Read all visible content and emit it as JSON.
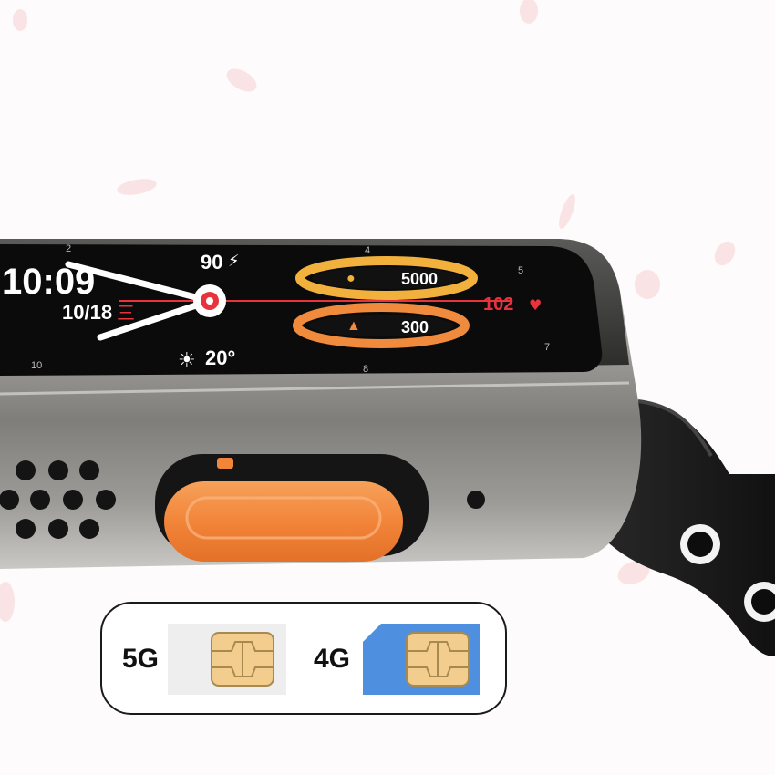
{
  "watch_face": {
    "time": "10:09",
    "date": "10/18",
    "weekday": "三",
    "battery": "90",
    "temperature": "20°",
    "steps": "5000",
    "calories": "300",
    "heart_rate": "102",
    "dial_numbers": [
      "2",
      "4",
      "5",
      "7",
      "8",
      "10"
    ]
  },
  "sim_options": [
    {
      "label": "5G",
      "card_color": "#eeeeee"
    },
    {
      "label": "4G",
      "card_color": "#4f8fe0"
    }
  ],
  "colors": {
    "port_cover": "#f28a3c",
    "ring_steps": "#f2b13c",
    "ring_calories": "#f08a3c",
    "accent_red": "#e8333c",
    "sim_chip": "#f2cd8d"
  }
}
